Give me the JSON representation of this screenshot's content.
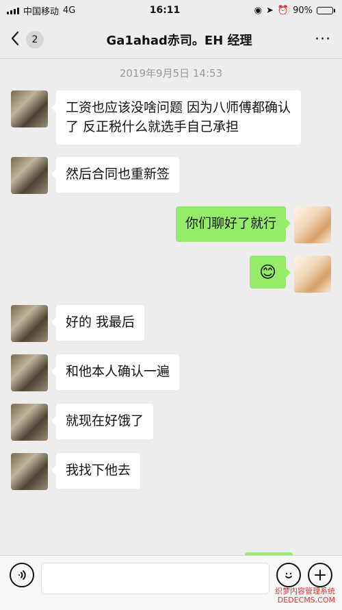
{
  "status_bar": {
    "carrier": "中国移动",
    "network": "4G",
    "time": "16:11",
    "battery": "90%",
    "battery_level": 0.9
  },
  "header": {
    "badge": "2",
    "title": "Ga1ahad赤司。EH 经理",
    "more": "···"
  },
  "chat": {
    "timestamp": "2019年9月5日 14:53",
    "messages": [
      {
        "side": "left",
        "text": " 工资也应该没啥问题 因为八师傅都确认了 反正税什么就选手自己承担"
      },
      {
        "side": "left",
        "text": "然后合同也重新签"
      },
      {
        "side": "right",
        "text": "你们聊好了就行"
      },
      {
        "side": "right",
        "text": "😊"
      },
      {
        "side": "left",
        "text": "好的 我最后"
      },
      {
        "side": "left",
        "text": "和他本人确认一遍"
      },
      {
        "side": "left",
        "text": "就现在好饿了"
      },
      {
        "side": "left",
        "text": "我找下他去"
      }
    ]
  },
  "bottom_bar": {
    "voice_icon": "voice-icon",
    "emoji_icon": "emoji-icon",
    "plus_icon": "plus-icon"
  },
  "watermark": {
    "line1": "织梦内容管理系统",
    "line2": "DEDECMS.COM"
  },
  "colors": {
    "background": "#ededed",
    "sent_bubble": "#95ec69",
    "received_bubble": "#ffffff",
    "watermark": "#d8342d"
  }
}
